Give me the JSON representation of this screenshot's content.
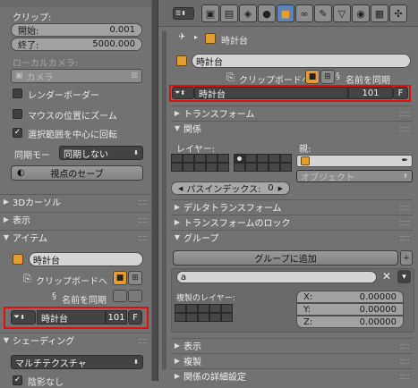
{
  "left": {
    "clip_label": "クリップ:",
    "clip_start_label": "開始:",
    "clip_start_value": "0.001",
    "clip_end_label": "終了:",
    "clip_end_value": "5000.000",
    "local_camera_label": "ローカルカメラ:",
    "camera_placeholder": "カメラ",
    "render_border": "レンダーボーダー",
    "zoom_to_mouse": "マウスの位置にズーム",
    "rotate_selection": "選択範囲を中心に回転",
    "sync_label": "同期モー",
    "sync_value": "同期しない",
    "save_view": "視点のセーブ",
    "cursor3d": "3Dカーソル",
    "display": "表示",
    "item": "アイテム",
    "object_name": "時計台",
    "clipboard": "クリップボードへ",
    "sync_name": "名前を同期",
    "action_name": "時計台",
    "action_users": "101",
    "action_fake": "F",
    "shading": "シェーディング",
    "multitexture": "マルチテクスチャ",
    "no_shadow": "陰影なし"
  },
  "right": {
    "breadcrumb": "時計台",
    "object_name": "時計台",
    "clipboard": "クリップボードへ",
    "sync_name": "名前を同期",
    "action_name": "時計台",
    "action_users": "101",
    "action_fake": "F",
    "transform": "トランスフォーム",
    "relations": "関係",
    "layers_label": "レイヤー:",
    "parent_label": "親:",
    "parent_type": "オブジェクト",
    "pass_index_label": "パスインデックス:",
    "pass_index_value": "0",
    "delta_transform": "デルタトランスフォーム",
    "transform_locks": "トランスフォームのロック",
    "groups": "グループ",
    "add_to_group": "グループに追加",
    "group_name": "a",
    "dupli_layers_label": "複製のレイヤー:",
    "offset": [
      {
        "axis": "X:",
        "value": "0.00000"
      },
      {
        "axis": "Y:",
        "value": "0.00000"
      },
      {
        "axis": "Z:",
        "value": "0.00000"
      }
    ],
    "display": "表示",
    "duplication": "複製",
    "relations_extras": "関係の詳細設定"
  },
  "colors": {
    "highlight": "#e01010",
    "accent": "#e59d2d"
  }
}
